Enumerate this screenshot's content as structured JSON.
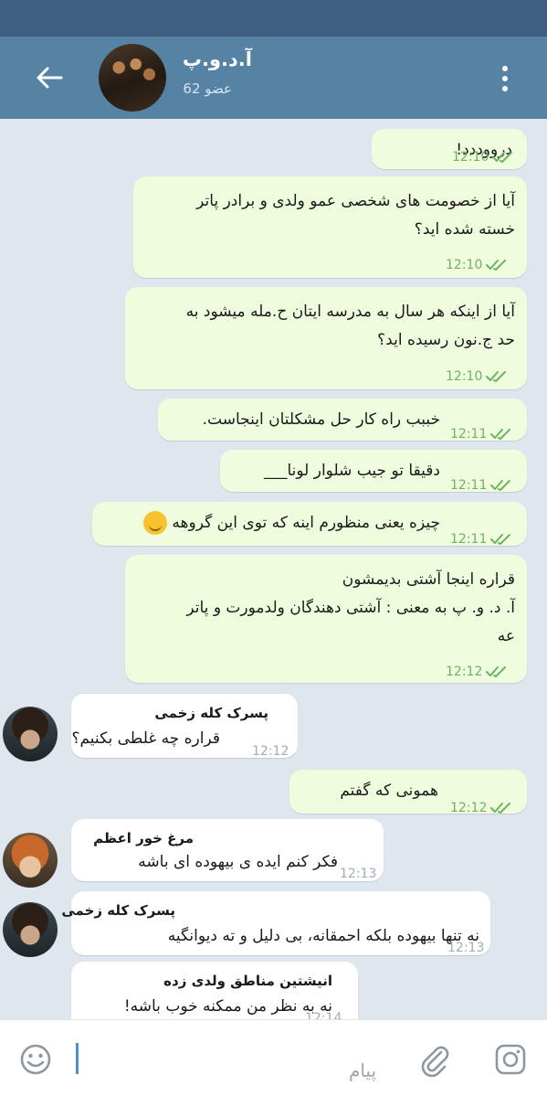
{
  "header": {
    "title": "آ.د.و.پ",
    "subtitle": "62 عضو"
  },
  "composer": {
    "placeholder": "پیام"
  },
  "messages": [
    {
      "lines": [
        "درووددد!"
      ],
      "time": "12:10"
    },
    {
      "lines": [
        "آیا از خصومت های شخصی عمو ولدی و برادر پاتر",
        "خسته شده اید؟"
      ],
      "time": "12:10"
    },
    {
      "lines": [
        "آیا از اینکه هر سال به مدرسه ایتان ح.مله میشود به",
        "حد ج.نون رسیده اید؟"
      ],
      "time": "12:10"
    },
    {
      "lines": [
        "خببب راه کار حل مشکلتان اینجاست."
      ],
      "time": "12:11"
    },
    {
      "lines": [
        "دقیقا تو جیب شلوار لونا___"
      ],
      "time": "12:11"
    },
    {
      "lines": [
        "چیزه یعنی منظورم اینه که توی این گروهه"
      ],
      "time": "12:11"
    },
    {
      "lines": [
        "قراره اینجا آشتی بدیمشون",
        "آ. د. و. پ به معنی : آشتی دهندگان ولدمورت و پاتر",
        "عه"
      ],
      "time": "12:12"
    },
    {
      "sender": "پسرک کله زخمی",
      "lines": [
        "قراره چه غلطی بکنیم؟"
      ],
      "time": "12:12"
    },
    {
      "lines": [
        "همونی که گفتم"
      ],
      "time": "12:12"
    },
    {
      "sender": "مرغ خور اعظم",
      "lines": [
        "فکر کنم ایده ی بیهوده ای باشه"
      ],
      "time": "12:13"
    },
    {
      "sender": "پسرک کله زخمی",
      "lines": [
        "نه تنها بیهوده بلکه احمقانه، بی دلیل و ته دیوانگیه"
      ],
      "time": "12:13"
    },
    {
      "sender": "انیشتین مناطق ولدی زده",
      "lines": [
        "نه به نظر من ممکنه خوب باشه!"
      ],
      "time": "12:14"
    }
  ],
  "colors": {
    "header": "#5682a3",
    "statusbar": "#3f5f80",
    "outgoing_bubble": "#effdde",
    "incoming_bubble": "#ffffff",
    "read_check": "#6fb264",
    "chat_background": "#dfe6ee"
  },
  "icons": [
    "back-arrow-icon",
    "more-vertical-icon",
    "double-check-icon",
    "emoji-face-icon",
    "paperclip-icon",
    "camera-icon",
    "smiling-face-emoji"
  ]
}
